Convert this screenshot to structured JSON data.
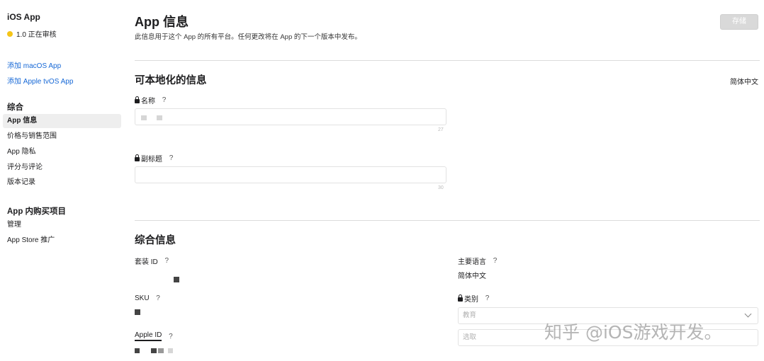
{
  "sidebar": {
    "app_title": "iOS App",
    "version": "1.0 正在审核",
    "status_color": "#f5c518",
    "add_macos": "添加 macOS App",
    "add_tvos": "添加 Apple tvOS App",
    "section_general": "综合",
    "items": [
      {
        "label": "App 信息",
        "active": true
      },
      {
        "label": "价格与销售范围"
      },
      {
        "label": "App 隐私"
      },
      {
        "label": "评分与评论"
      },
      {
        "label": "版本记录"
      }
    ],
    "section_iap": "App 内购买项目",
    "iap_items": [
      {
        "label": "管理"
      },
      {
        "label": "App Store 推广"
      }
    ]
  },
  "main": {
    "title": "App 信息",
    "subtitle": "此信息用于这个 App 的所有平台。任何更改将在 App 的下一个版本中发布。",
    "save_label": "存储",
    "localizable": {
      "title": "可本地化的信息",
      "language": "简体中文",
      "name_label": "名称",
      "name_help": "?",
      "name_counter": "27",
      "subtitle_label": "副标题",
      "subtitle_help": "?",
      "subtitle_counter": "30"
    },
    "general": {
      "title": "综合信息",
      "bundle_id_label": "套装 ID",
      "bundle_help": "?",
      "sku_label": "SKU",
      "sku_help": "?",
      "apple_id_label": "Apple ID",
      "apple_id_help": "?",
      "primary_language_label": "主要语言",
      "primary_language_help": "?",
      "primary_language_value": "简体中文",
      "category_label": "类别",
      "category_help": "?",
      "category_primary": "教育",
      "category_secondary": "选取"
    }
  },
  "watermark": "知乎 @iOS游戏开发。"
}
